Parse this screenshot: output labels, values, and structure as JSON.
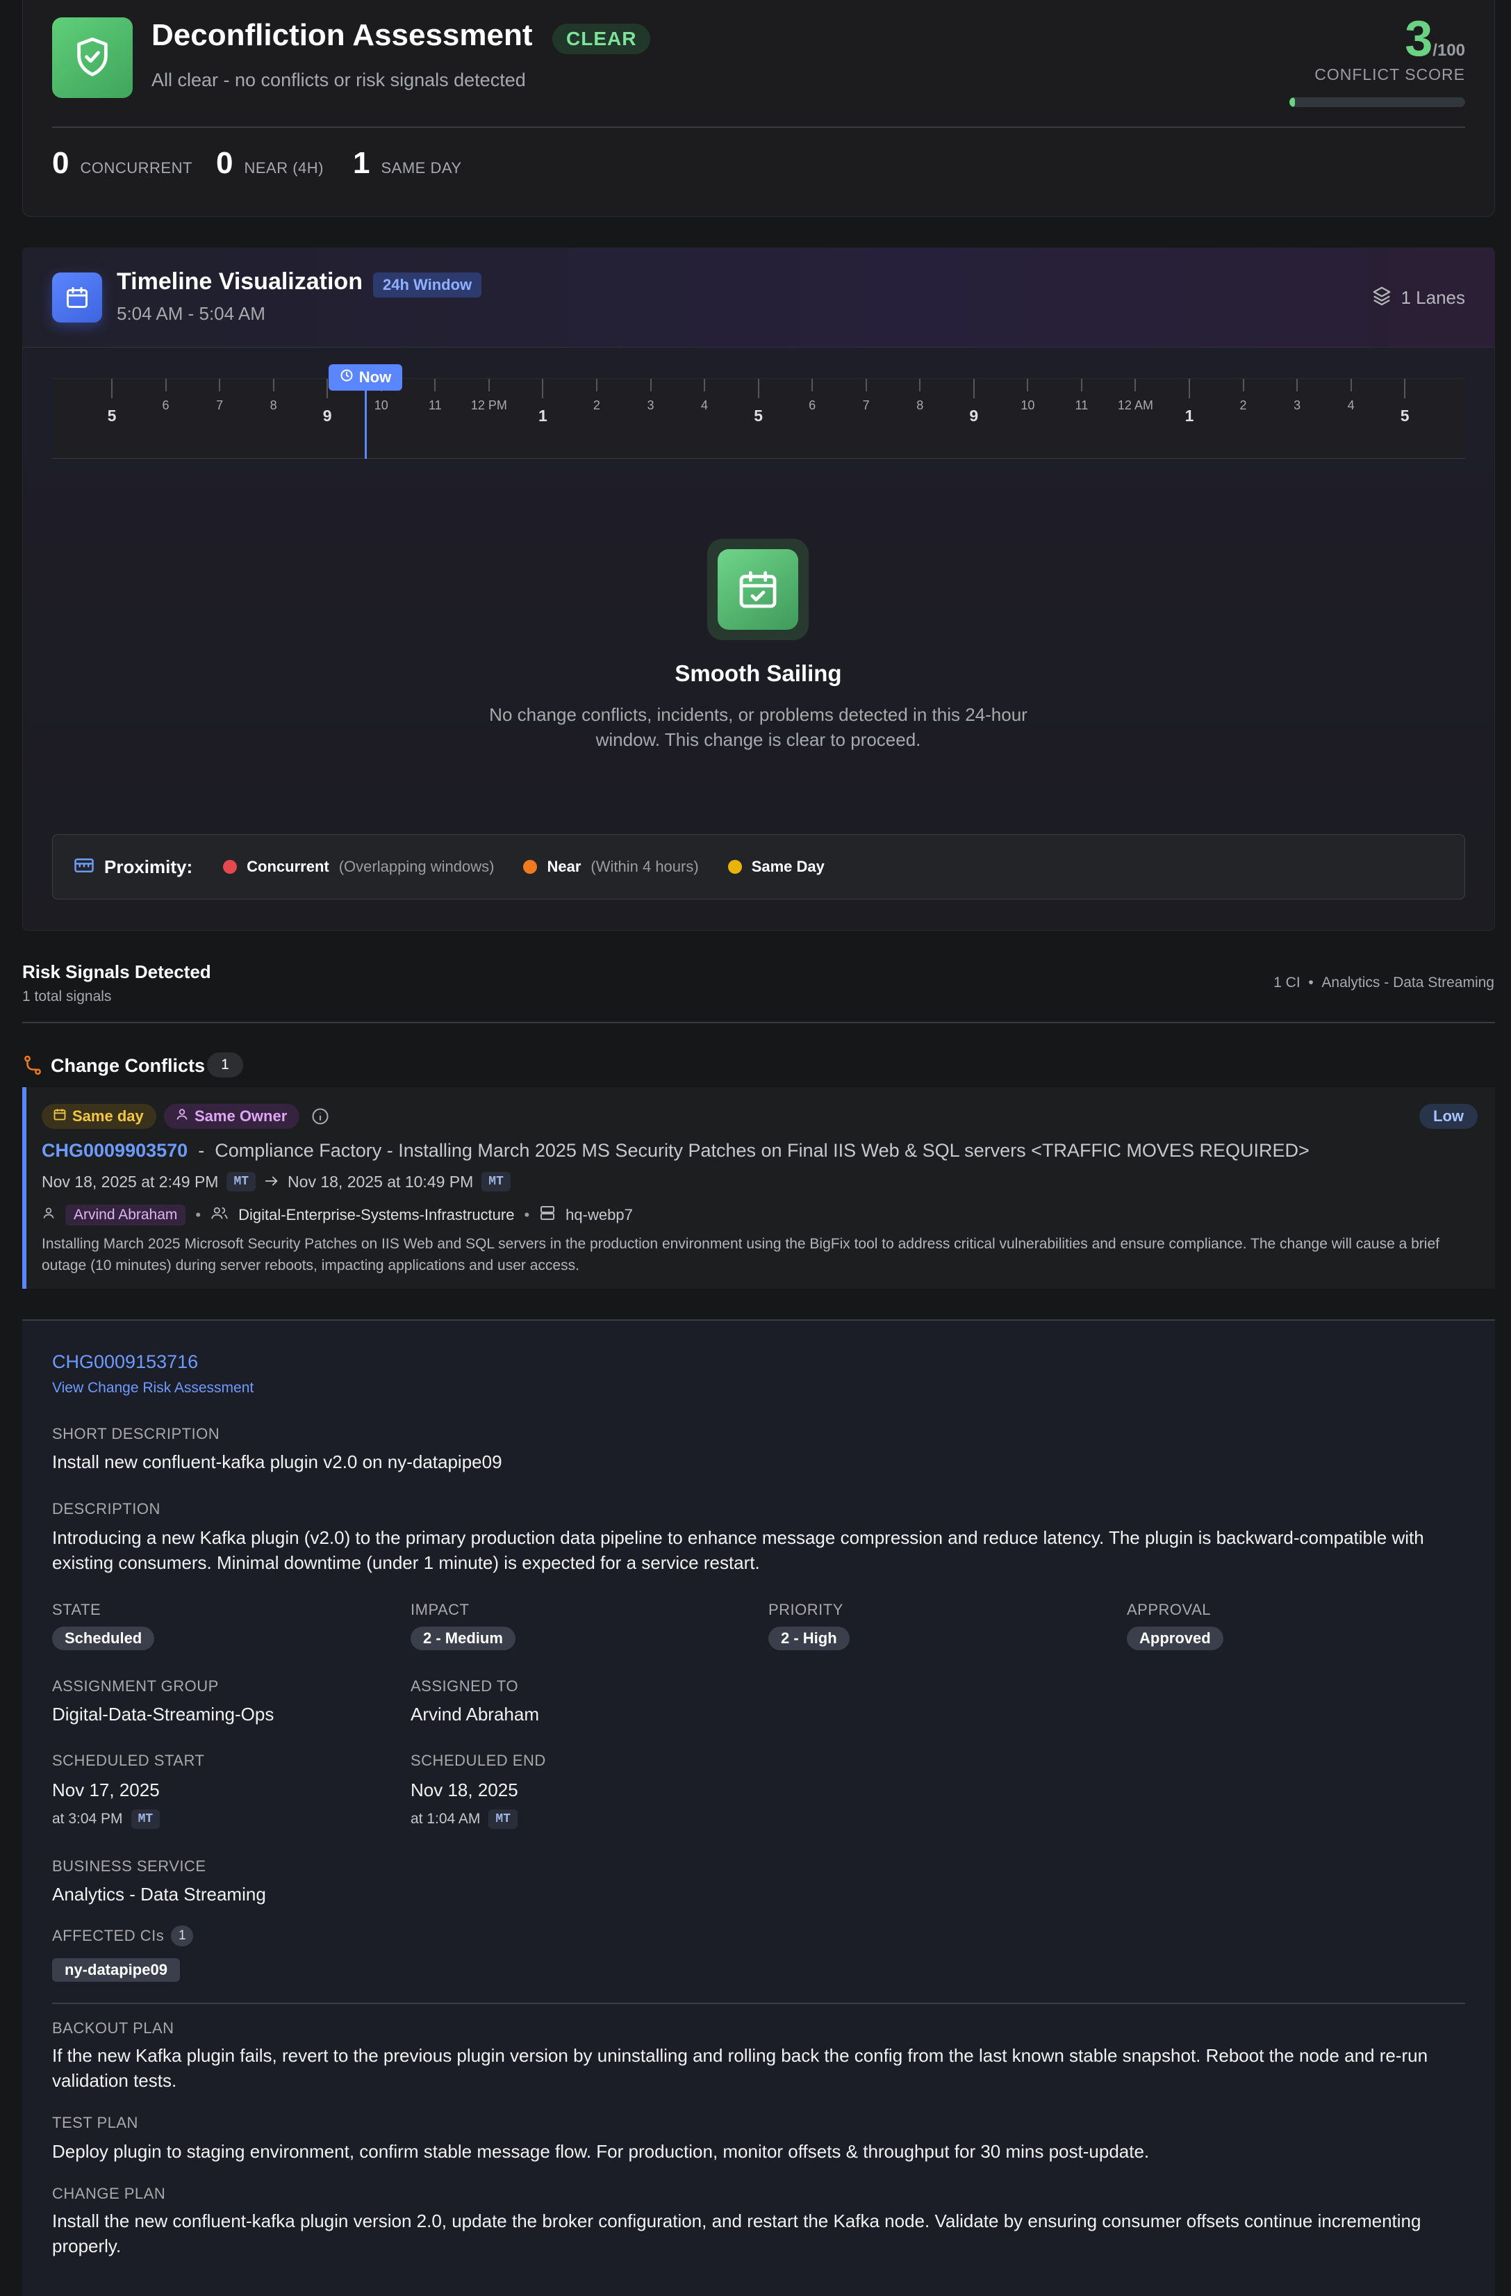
{
  "header": {
    "title": "Deconfliction Assessment",
    "status_badge": "CLEAR",
    "subtitle": "All clear - no conflicts or risk signals detected",
    "score": "3",
    "score_max": "/100",
    "score_label": "CONFLICT SCORE",
    "score_fraction": 0.03,
    "stats": [
      {
        "value": "0",
        "label": "CONCURRENT"
      },
      {
        "value": "0",
        "label": "NEAR (4H)"
      },
      {
        "value": "1",
        "label": "SAME DAY"
      }
    ],
    "accent_color": "#6bd283"
  },
  "timeline": {
    "title": "Timeline Visualization",
    "window_badge": "24h Window",
    "range": "5:04 AM - 5:04 AM",
    "lanes": "1 Lanes",
    "now_label": "Now",
    "ticks": [
      "5",
      "6",
      "7",
      "8",
      "9",
      "10",
      "11",
      "12 PM",
      "1",
      "2",
      "3",
      "4",
      "5",
      "6",
      "7",
      "8",
      "9",
      "10",
      "11",
      "12 AM",
      "1",
      "2",
      "3",
      "4",
      "5"
    ],
    "major_ticks": [
      0,
      4,
      8,
      12,
      16,
      20,
      24
    ],
    "now_index": 4.7,
    "empty_title": "Smooth Sailing",
    "empty_text": "No change conflicts, incidents, or problems detected in this 24-hour window. This change is clear to proceed.",
    "proximity": {
      "label": "Proximity:",
      "items": [
        {
          "name": "Concurrent",
          "desc": "(Overlapping windows)",
          "color": "#e5484d"
        },
        {
          "name": "Near",
          "desc": "(Within 4 hours)",
          "color": "#f07b1e"
        },
        {
          "name": "Same Day",
          "desc": "",
          "color": "#eab308"
        }
      ]
    }
  },
  "risk": {
    "title": "Risk Signals Detected",
    "total": "1 total signals",
    "ci_count": "1 CI",
    "service": "Analytics - Data Streaming"
  },
  "conflicts": {
    "title": "Change Conflicts",
    "count": "1",
    "item": {
      "tag_same_day": "Same day",
      "tag_same_owner": "Same Owner",
      "risk": "Low",
      "number": "CHG0009903570",
      "separator": "-",
      "short_desc": "Compliance Factory - Installing March 2025 MS Security Patches on Final IIS Web & SQL servers <TRAFFIC MOVES REQUIRED>",
      "start": "Nov 18, 2025 at 2:49 PM",
      "end": "Nov 18, 2025 at 10:49 PM",
      "tz": "MT",
      "owner": "Arvind Abraham",
      "group": "Digital-Enterprise-Systems-Infrastructure",
      "ci": "hq-webp7",
      "description": "Installing March 2025 Microsoft Security Patches on IIS Web and SQL servers in the production environment using the BigFix tool to address critical vulnerabilities and ensure compliance. The change will cause a brief outage (10 minutes) during server reboots, impacting applications and user access."
    }
  },
  "change": {
    "number": "CHG0009153716",
    "risk_link": "View Change Risk Assessment",
    "short_desc_label": "SHORT DESCRIPTION",
    "short_desc": "Install new confluent-kafka plugin v2.0 on ny-datapipe09",
    "desc_label": "DESCRIPTION",
    "description": "Introducing a new Kafka plugin (v2.0) to the primary production data pipeline to enhance message compression and reduce latency. The plugin is backward-compatible with existing consumers. Minimal downtime (under 1 minute) is expected for a service restart.",
    "state_label": "STATE",
    "state": "Scheduled",
    "impact_label": "IMPACT",
    "impact": "2 - Medium",
    "priority_label": "PRIORITY",
    "priority": "2 - High",
    "approval_label": "APPROVAL",
    "approval": "Approved",
    "group_label": "ASSIGNMENT GROUP",
    "group": "Digital-Data-Streaming-Ops",
    "assigned_label": "ASSIGNED TO",
    "assigned": "Arvind Abraham",
    "start_label": "SCHEDULED START",
    "start_date": "Nov 17, 2025",
    "start_time": "at 3:04 PM",
    "end_label": "SCHEDULED END",
    "end_date": "Nov 18, 2025",
    "end_time": "at 1:04 AM",
    "tz": "MT",
    "service_label": "BUSINESS SERVICE",
    "service": "Analytics - Data Streaming",
    "cis_label": "AFFECTED CIs",
    "cis_count": "1",
    "ci": "ny-datapipe09",
    "backout_label": "BACKOUT PLAN",
    "backout": "If the new Kafka plugin fails, revert to the previous plugin version by uninstalling and rolling back the config from the last known stable snapshot. Reboot the node and re-run validation tests.",
    "test_label": "TEST PLAN",
    "test": "Deploy plugin to staging environment, confirm stable message flow. For production, monitor offsets & throughput for 30 mins post-update.",
    "plan_label": "CHANGE PLAN",
    "plan": "Install the new confluent-kafka plugin version 2.0, update the broker configuration, and restart the Kafka node. Validate by ensuring consumer offsets continue incrementing properly."
  }
}
